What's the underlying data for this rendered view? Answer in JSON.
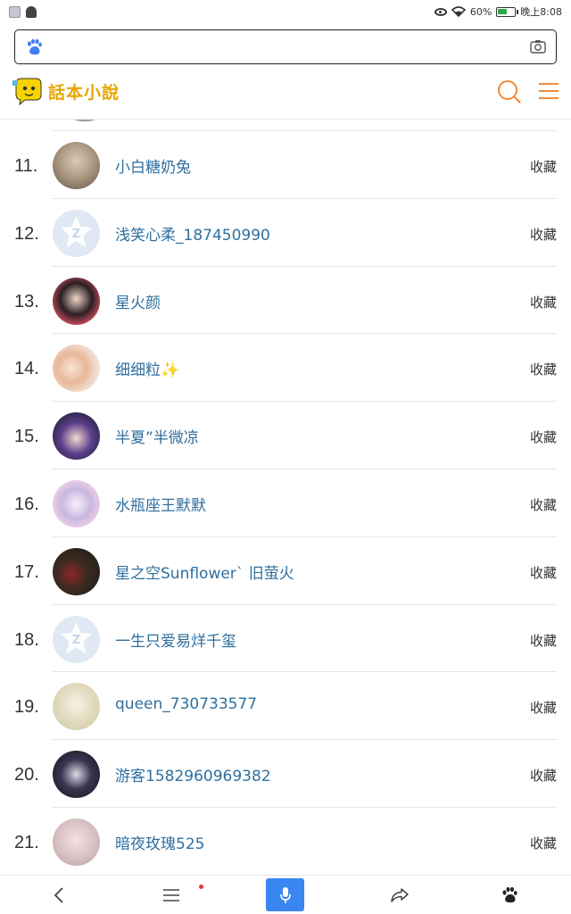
{
  "status_bar": {
    "battery_percent": 60,
    "battery_text": "60%",
    "time": "晚上8:08"
  },
  "search": {
    "value": "",
    "placeholder": ""
  },
  "site": {
    "logo_text": "話本小說"
  },
  "icons": {
    "search_bar_left": "baidu-paw-icon",
    "search_bar_right": "camera-icon",
    "header_right": [
      "search-icon",
      "menu-icon"
    ],
    "bottom_nav": [
      "back-icon",
      "menu-icon",
      "mic-icon",
      "share-icon",
      "baidu-paw-icon"
    ]
  },
  "colors": {
    "accent_orange": "#f08c3c",
    "name_blue": "#2f6f9e",
    "mic_blue": "#3a86f0",
    "logo_yellow": "#e9a400"
  },
  "rows": [
    {
      "rank": "11.",
      "name": "小白糖奶兔",
      "action": "收藏",
      "avatar": "photo-girl-avatar"
    },
    {
      "rank": "12.",
      "name": "浅笑心柔_187450990",
      "action": "收藏",
      "avatar": "default-z-avatar"
    },
    {
      "rank": "13.",
      "name": "星火颜",
      "action": "收藏",
      "avatar": "anime-character-avatar"
    },
    {
      "rank": "14.",
      "name": "细细粒✨",
      "action": "收藏",
      "avatar": "anime-girl-avatar"
    },
    {
      "rank": "15.",
      "name": "半夏”半微凉",
      "action": "收藏",
      "avatar": "anime-purple-hair-avatar"
    },
    {
      "rank": "16.",
      "name": "水瓶座王默默",
      "action": "收藏",
      "avatar": "anime-pastel-avatar"
    },
    {
      "rank": "17.",
      "name": "星之空Sunflower` 旧萤火",
      "action": "收藏",
      "avatar": "photo-dark-avatar"
    },
    {
      "rank": "18.",
      "name": "一生只爱易烊千玺",
      "action": "收藏",
      "avatar": "default-z-avatar"
    },
    {
      "rank": "19.",
      "name": "queen_730733577",
      "action": "收藏",
      "avatar": "anime-light-avatar"
    },
    {
      "rank": "20.",
      "name": "游客1582960969382",
      "action": "收藏",
      "avatar": "anime-dark-avatar"
    },
    {
      "rank": "21.",
      "name": "暗夜玫瑰525",
      "action": "收藏",
      "avatar": "anime-soft-avatar"
    }
  ]
}
